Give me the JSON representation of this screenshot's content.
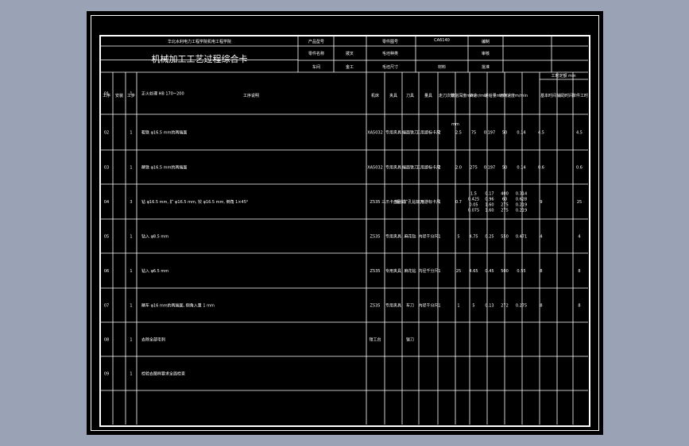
{
  "header": {
    "university": "华北水利电力工程学院机电工程学院",
    "card_title": "机械加工工艺过程综合卡",
    "product_no_label": "产品型号",
    "part_name_label": "零件名称",
    "part_name": "拨叉",
    "blank_type_label": "毛坯种类",
    "blank_type": "铸件",
    "part_no_label": "零件图号",
    "part_no_value": "CA6140",
    "material_label": "材料",
    "material": "HT25-40",
    "compiled_label": "编制",
    "checked_label": "审核",
    "approved_label": "批准",
    "blank_size_label": "毛坯尺寸",
    "workshop_label": "车间",
    "workshop": "金工",
    "process_label": "工序",
    "process_value": "机械加工"
  },
  "columns": {
    "process_no": "工序",
    "install": "安装",
    "step_no": "工步",
    "content": "工序说明",
    "machine": "机床",
    "fixture": "夹具",
    "tool": "刀具",
    "gauge": "量具",
    "passes": "走刀次数",
    "depth": "切削深度mm",
    "speed": "转速r/min",
    "feed": "进给量mm/r",
    "cut_speed": "切削速度m/min",
    "basic_time": "基本时间",
    "aux_time": "辅助时间",
    "single_time": "单件工时",
    "time_unit": "工时定额 min",
    "mm_mark": "mm"
  },
  "rows": [
    {
      "op": "01",
      "steps": "1",
      "content": "正火处理 HB 170~200",
      "machine": "",
      "fixture": "",
      "tool": "",
      "gauge": "",
      "passes": "",
      "depth": "",
      "speed": "",
      "feed": "",
      "vc": "",
      "t1": "",
      "t2": "",
      "t3": ""
    },
    {
      "op": "02",
      "steps": "1",
      "content": "粗铣 φ16.5 mm的两端面",
      "machine": "XA5032",
      "fixture": "专用夹具",
      "tool": "端面铣刀",
      "gauge": "三用游标卡尺",
      "passes": "2",
      "depth": "2.5",
      "speed": "75",
      "feed": "0.197",
      "vc": "50",
      "t1": "0.14",
      "t2": "4.5",
      "t3": "4.5"
    },
    {
      "op": "03",
      "steps": "1",
      "content": "精铣 φ16.5 mm的两端面",
      "machine": "XA5032",
      "fixture": "专用夹具",
      "tool": "端面铣刀",
      "gauge": "三用游标卡尺",
      "passes": "2",
      "depth": "2.0",
      "speed": "275",
      "feed": "0.197",
      "vc": "50",
      "t1": "0.14",
      "t2": "0.6",
      "t3": "0.6"
    },
    {
      "op": "04",
      "steps": "3",
      "content": "钻 φ16.5 mm, 扩 φ16.5 mm, 铰 φ16.5 mm, 倒角 1×45°",
      "machine": "Z535",
      "fixture": "三爪卡盘卧式",
      "tool": "钻头扩孔钻铰刀",
      "gauge": "三用游标卡尺",
      "passes": "1",
      "depth": "0.7",
      "speed": "1.5 / 0.425 / 0.05 / 0.075",
      "feed": "0.17 / 0.96 / 1.60 / 1.60",
      "vc": "400 / 60 / 275 / 275",
      "t1": "0.314 / 0.628 / 0.219 / 0.219",
      "t2": "9",
      "t3": "25"
    },
    {
      "op": "05",
      "steps": "1",
      "content": "钻入 φ8.5 mm",
      "machine": "Z535",
      "fixture": "专用夹具",
      "tool": "麻花钻",
      "gauge": "内径千分尺",
      "passes": "1",
      "depth": "5",
      "speed": "4.75",
      "feed": "0.25",
      "vc": "550",
      "t1": "0.471",
      "t2": "4",
      "t3": "4"
    },
    {
      "op": "06",
      "steps": "1",
      "content": "钻入 φ6.5 mm",
      "machine": "Z535",
      "fixture": "专用夹具",
      "tool": "麻花钻",
      "gauge": "内径千分尺",
      "passes": "1",
      "depth": "25",
      "speed": "4.65",
      "feed": "0.45",
      "vc": "500",
      "t1": "0.55",
      "t2": "8",
      "t3": "8"
    },
    {
      "op": "07",
      "steps": "1",
      "content": "精车 φ16 mm的两端面, 倒角入量 1 mm",
      "machine": "Z535",
      "fixture": "专用夹具",
      "tool": "车刀",
      "gauge": "内径千分尺",
      "passes": "1",
      "depth": "1",
      "speed": "5",
      "feed": "0.13",
      "vc": "272",
      "t1": "0.275",
      "t2": "8",
      "t3": "8"
    },
    {
      "op": "08",
      "steps": "1",
      "content": "去除全部毛刺",
      "machine": "钳工台",
      "fixture": "",
      "tool": "锉刀",
      "gauge": "",
      "passes": "",
      "depth": "",
      "speed": "",
      "feed": "",
      "vc": "",
      "t1": "",
      "t2": "",
      "t3": ""
    },
    {
      "op": "09",
      "steps": "1",
      "content": "检验去图样要求全面检查",
      "machine": "",
      "fixture": "",
      "tool": "",
      "gauge": "",
      "passes": "",
      "depth": "",
      "speed": "",
      "feed": "",
      "vc": "",
      "t1": "",
      "t2": "",
      "t3": ""
    }
  ]
}
